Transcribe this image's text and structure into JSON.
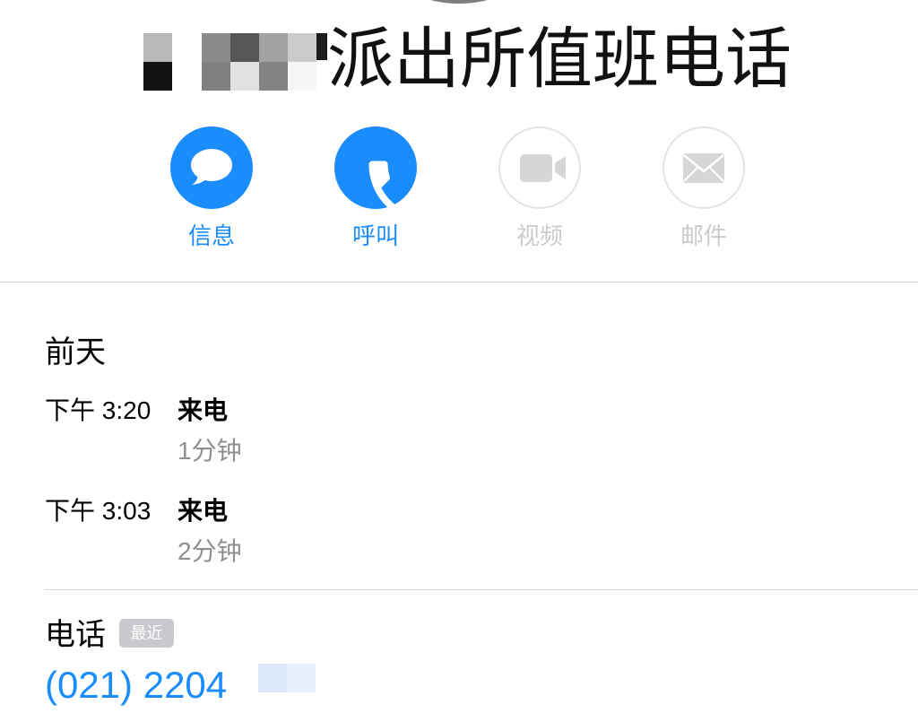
{
  "contact": {
    "title": "派出所值班电话"
  },
  "actions": [
    {
      "label": "信息",
      "icon": "message-bubble-icon",
      "enabled": true
    },
    {
      "label": "呼叫",
      "icon": "phone-icon",
      "enabled": true
    },
    {
      "label": "视频",
      "icon": "video-camera-icon",
      "enabled": false
    },
    {
      "label": "邮件",
      "icon": "envelope-icon",
      "enabled": false
    }
  ],
  "call_history": {
    "day": "前天",
    "calls": [
      {
        "time": "下午 3:20",
        "type": "来电",
        "duration": "1分钟"
      },
      {
        "time": "下午 3:03",
        "type": "来电",
        "duration": "2分钟"
      }
    ]
  },
  "phone": {
    "label": "电话",
    "badge": "最近",
    "number": "(021) 2204"
  },
  "colors": {
    "accent": "#1a8cfb",
    "disabled": "#d3d3d6",
    "secondary_text": "#8e8e93",
    "badge_bg": "#c8c8cd",
    "divider": "#d8d8d8"
  }
}
